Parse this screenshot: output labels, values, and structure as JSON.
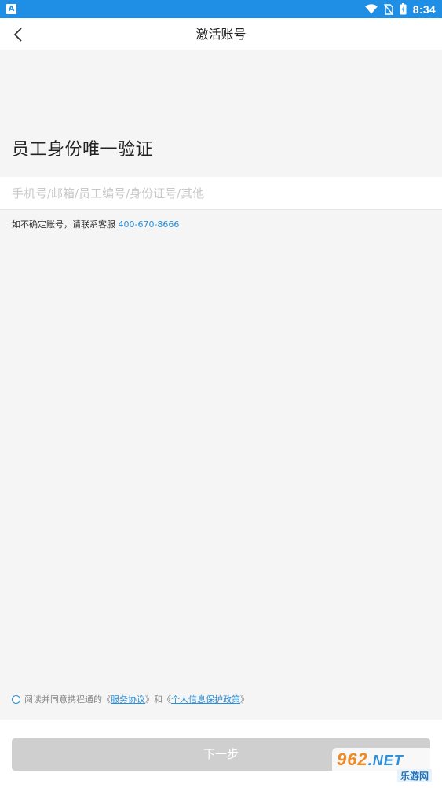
{
  "status_bar": {
    "app_badge": "A",
    "time": "8:34",
    "icons": [
      "wifi-icon",
      "no-sim-icon",
      "battery-icon"
    ]
  },
  "navbar": {
    "back_icon": "chevron-left-icon",
    "title": "激活账号"
  },
  "main": {
    "heading": "员工身份唯一验证",
    "account_input": {
      "value": "",
      "placeholder": "手机号/邮箱/员工编号/身份证号/其他"
    },
    "help_text": "如不确定账号，请联系客服",
    "help_phone": "400-670-8666"
  },
  "agreement": {
    "checked": false,
    "prefix": "阅读并同意携程通的《",
    "service_link": "服务协议",
    "middle": "》和《",
    "privacy_link": "个人信息保护政策",
    "suffix": "》"
  },
  "next_button": {
    "label": "下一步",
    "enabled": false
  },
  "watermark": {
    "top_digits": "962",
    "top_suffix": ".NET",
    "bottom": "乐游网"
  },
  "colors": {
    "status_bar": "#1f8fe6",
    "link": "#2a8fd6",
    "button_disabled": "#cfcfcf",
    "background": "#f5f5f5"
  }
}
